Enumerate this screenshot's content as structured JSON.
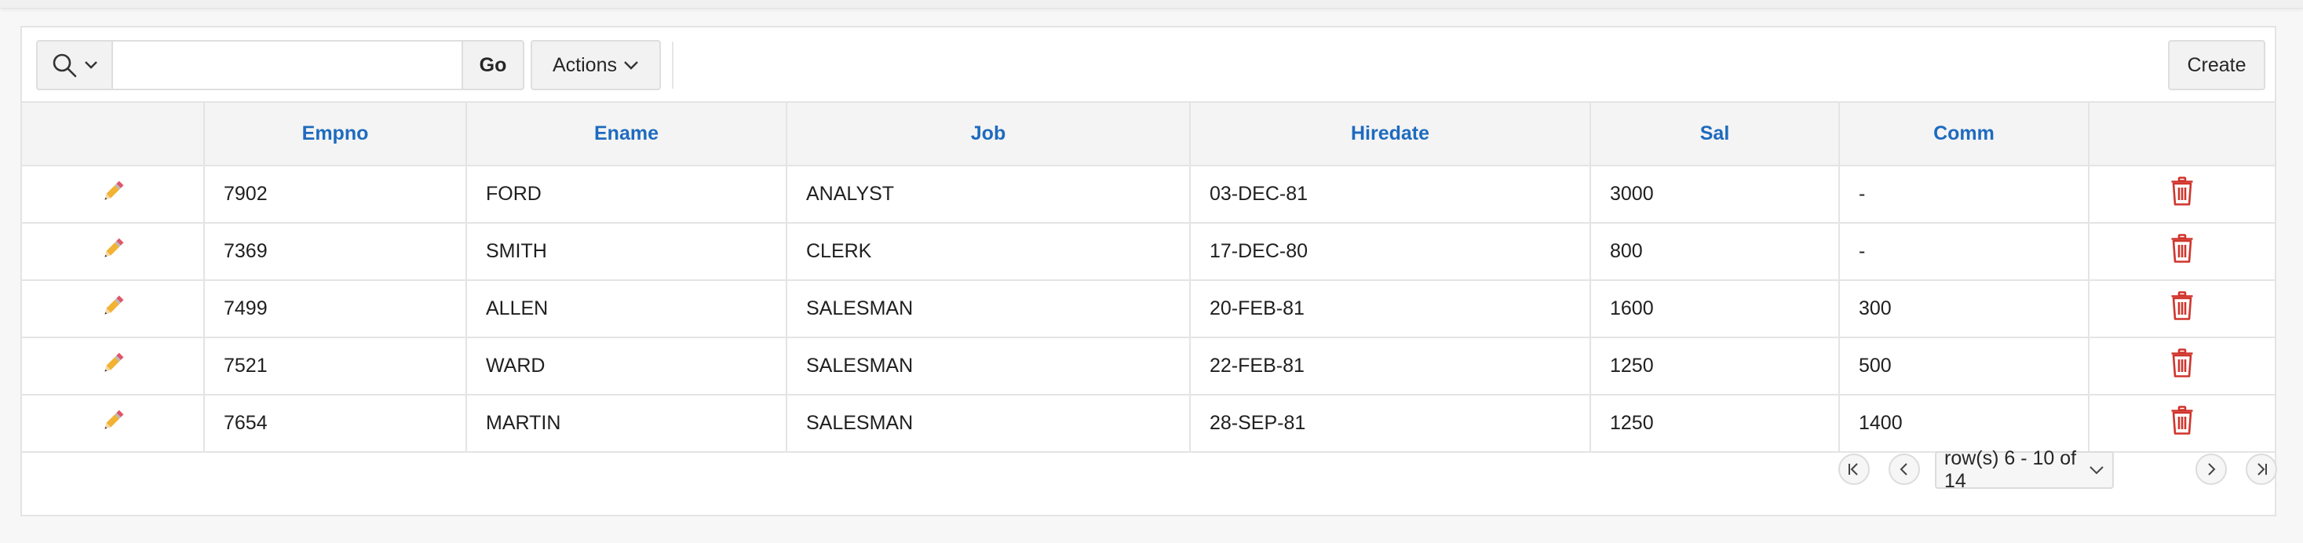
{
  "toolbar": {
    "search_placeholder": "",
    "go_label": "Go",
    "actions_label": "Actions",
    "create_label": "Create"
  },
  "table": {
    "columns": [
      "",
      "Empno",
      "Ename",
      "Job",
      "Hiredate",
      "Sal",
      "Comm",
      ""
    ],
    "rows": [
      {
        "empno": "7902",
        "ename": "FORD",
        "job": "ANALYST",
        "hiredate": "03-DEC-81",
        "sal": "3000",
        "comm": "-"
      },
      {
        "empno": "7369",
        "ename": "SMITH",
        "job": "CLERK",
        "hiredate": "17-DEC-80",
        "sal": "800",
        "comm": "-"
      },
      {
        "empno": "7499",
        "ename": "ALLEN",
        "job": "SALESMAN",
        "hiredate": "20-FEB-81",
        "sal": "1600",
        "comm": "300"
      },
      {
        "empno": "7521",
        "ename": "WARD",
        "job": "SALESMAN",
        "hiredate": "22-FEB-81",
        "sal": "1250",
        "comm": "500"
      },
      {
        "empno": "7654",
        "ename": "MARTIN",
        "job": "SALESMAN",
        "hiredate": "28-SEP-81",
        "sal": "1250",
        "comm": "1400"
      }
    ]
  },
  "pagination": {
    "range_label": "row(s) 6 - 10 of 14"
  },
  "icons": {
    "row_edit": "pencil-icon",
    "row_delete": "trash-icon",
    "search": "search-icon"
  },
  "colors": {
    "header_link": "#1e6bbf",
    "delete_icon": "#d0342c",
    "pencil_body": "#f2b233"
  }
}
